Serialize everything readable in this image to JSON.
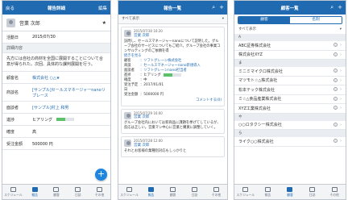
{
  "colors": {
    "header": "#1f6ab0",
    "accent": "#1f86e0",
    "progress": "#5cc16b"
  },
  "tabs": [
    "スケジュール",
    "報告",
    "顧客",
    "日誌",
    "その他"
  ],
  "detail": {
    "back": "戻る",
    "title": "報告詳細",
    "edit": "編集",
    "name": "営業 次郎",
    "activity_label": "活動日",
    "activity_date": "2015/07/30",
    "section": "詳細内容",
    "body": "先方には自社の商材を全国に展開することについて合意が得られた。次回、具体的な課判展開を行う。",
    "customer_label": "顧客名",
    "customer": "株式会社 ○△★",
    "deal_label": "商談名",
    "deal": "[サンプル]セールスマネージャーnanoリプレース",
    "person_label": "面談者",
    "person": "[サンプル]村上 和男",
    "progress_label": "進捗",
    "progress_value": "ヒアリング",
    "progress_fraction": 0.5,
    "certainty_label": "確度",
    "certainty": "高",
    "amount_label": "受注金額",
    "amount": "500000 円"
  },
  "list": {
    "title": "報告一覧",
    "filter": "すべて表示",
    "card1": {
      "date": "2015/07/30 16:20",
      "who": "営業 次郎",
      "text": "訪問し、セールスマネージャーnanoについて説明した。グループ会社のサービスについてもご紹介。グループ会社の事業コンサルティングのご依頼を得",
      "more": "続きを見る",
      "customer_k": "顧客",
      "customer": "：ソフトグレーン株式会社",
      "deal_k": "商談",
      "deal": "：セールスマネージャーnano新規導入",
      "person_k": "面談者",
      "person": "：ソフトグレーンnano担当者",
      "progress_k": "進捗",
      "progress": "：ヒアリング",
      "progress_fraction": 0.5,
      "certainty_k": "確度",
      "certainty": "：中",
      "due_k": "受注予定日",
      "due": "：2017/01/01",
      "amount_k": "受注金額",
      "amount": "：5000000 円",
      "comment": "コメントする",
      "count": "(0)"
    },
    "card2": {
      "date": "2015/07/29 16:00",
      "who": "営業 次郎",
      "text": "グループ会社内においては新商品に課題を挙げてしているが、反応は乏しい。営業マン中心に営業と購買に調整していく。"
    },
    "card3": {
      "date": "2015/07/28 12:00",
      "who": "営業 次郎",
      "text": "それとお客様の業種別対応もしっかりと"
    }
  },
  "customers": {
    "title": "顧客一覧",
    "seg_customer": "顧客",
    "seg_card": "名刺",
    "filter": "すべて表示",
    "groups": [
      {
        "label": "A",
        "items": [
          "ABC証券株式会社",
          "株式会社XYZ"
        ]
      },
      {
        "label": "ま",
        "items": [
          "ミニミマイクロ株式会社",
          "マツモト☆△株式会社",
          "松本テック株式会社",
          "ミ☆△食品産業株式会社",
          "XYZ工業株式会社"
        ]
      },
      {
        "label": "や",
        "items": [
          "○○ロタクシー株式会社"
        ]
      },
      {
        "label": "ら",
        "items": [
          "ライク○○株式会社"
        ]
      }
    ]
  }
}
